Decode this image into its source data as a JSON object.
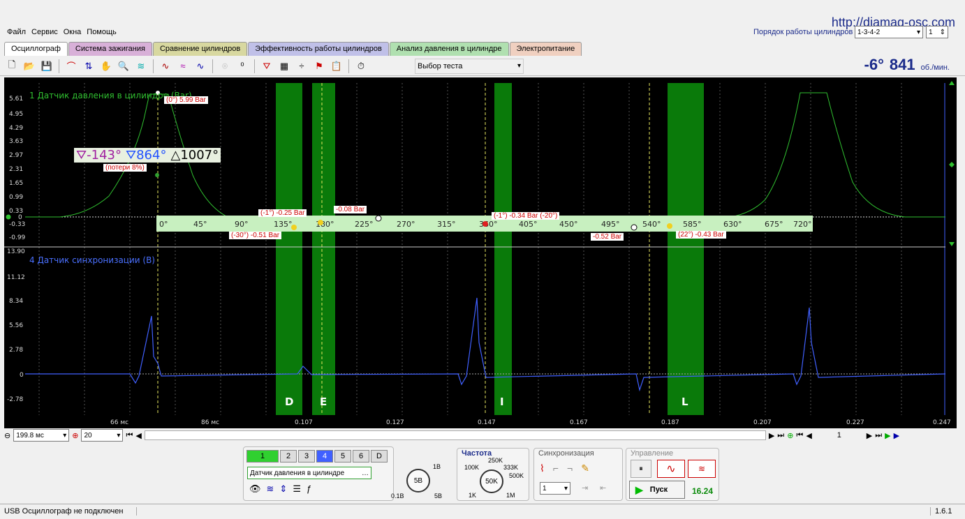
{
  "url": "http://diamag-osc.com",
  "menu": [
    "Файл",
    "Сервис",
    "Окна",
    "Помощь"
  ],
  "firing_order": {
    "label": "Порядок работы цилиндров",
    "value": "1-3-4-2",
    "cyl": "1"
  },
  "tabs": [
    {
      "label": "Осциллограф",
      "color": "#ffffff"
    },
    {
      "label": "Система зажигания",
      "color": "#d8b0d8"
    },
    {
      "label": "Сравнение цилиндров",
      "color": "#d8d8a0"
    },
    {
      "label": "Эффективность работы цилиндров",
      "color": "#c0c0e8"
    },
    {
      "label": "Анализ давления в цилиндре",
      "color": "#b0e0b0"
    },
    {
      "label": "Электропитание",
      "color": "#f0d0c0"
    }
  ],
  "test_select": "Выбор теста",
  "rpm": {
    "angle": "-6°",
    "value": "841",
    "unit": "об./мин."
  },
  "pressure": {
    "title": "1 Датчик давления в цилиндре (Bar)",
    "yticks": [
      "5.61",
      "4.95",
      "4.29",
      "3.63",
      "2.97",
      "2.31",
      "1.65",
      "0.99",
      "0.33",
      "0",
      "-0.33",
      "-0.99"
    ],
    "angle_ticks": [
      "0°",
      "45°",
      "90°",
      "135°",
      "180°",
      "225°",
      "270°",
      "315°",
      "360°",
      "405°",
      "450°",
      "495°",
      "540°",
      "585°",
      "630°",
      "675°",
      "720°"
    ],
    "angles": {
      "a1": "-143°",
      "a2": "864°",
      "a3": "1007°"
    },
    "loss": "(потери 8%)",
    "labels": {
      "top": "(0°) 5.99 Bar",
      "m1": "(-1°) -0.25 Bar",
      "m2": "-0.08 Bar",
      "m3": "(-30°) -0.51 Bar",
      "m4": "(-1°) -0.34 Bar (-20°)",
      "m5": "-0.52 Bar",
      "m6": "(22°) -0.43 Bar"
    }
  },
  "sync": {
    "title": "4 Датчик синхронизации (В)",
    "yticks": [
      "13.90",
      "11.12",
      "8.34",
      "5.56",
      "2.78",
      "0",
      "-2.78"
    ]
  },
  "zones": [
    "D",
    "E",
    "I",
    "L"
  ],
  "time_ticks": [
    "66 мс",
    "86 мс",
    "0.107",
    "0.127",
    "0.147",
    "0.167",
    "0.187",
    "0.207",
    "0.227",
    "0.247"
  ],
  "bottom": {
    "timebase": "199.8 мс",
    "count": "20",
    "page": "1"
  },
  "channels": [
    "1",
    "2",
    "3",
    "4",
    "5",
    "6",
    "D"
  ],
  "channel_name": "Датчик давления в цилиндре",
  "volt": {
    "center": "5В",
    "min": "0.1В",
    "max": "5В",
    "top": "1В"
  },
  "freq": {
    "title": "Частота",
    "center": "50K",
    "labels": [
      "250K",
      "100K",
      "333K",
      "500K",
      "1K",
      "1M"
    ]
  },
  "syncpanel": {
    "title": "Синхронизация",
    "value": "1"
  },
  "control": {
    "title": "Управление",
    "start": "Пуск",
    "value": "16.24"
  },
  "status": {
    "text": "USB Осциллограф не подключен",
    "version": "1.6.1"
  }
}
